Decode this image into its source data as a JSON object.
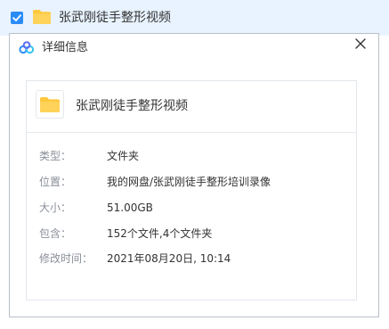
{
  "file_row": {
    "name": "张武刚徒手整形视频",
    "selected": true,
    "accent_color": "#2b8cf6",
    "row_bg_color": "#e8f3ff"
  },
  "dialog": {
    "title": "详细信息",
    "logo_icon": "baidu-netdisk-logo-icon",
    "close_icon": "close-icon",
    "item_name": "张武刚徒手整形视频",
    "folder_color": "#ffc83d",
    "details": [
      {
        "label": "类型：",
        "value": "文件夹"
      },
      {
        "label": "位置：",
        "value": "我的网盘/张武刚徒手整形培训录像"
      },
      {
        "label": "大小：",
        "value": "51.00GB"
      },
      {
        "label": "包含：",
        "value": "152个文件,4个文件夹"
      },
      {
        "label": "修改时间：",
        "value": "2021年08月20日, 10:14"
      }
    ]
  }
}
